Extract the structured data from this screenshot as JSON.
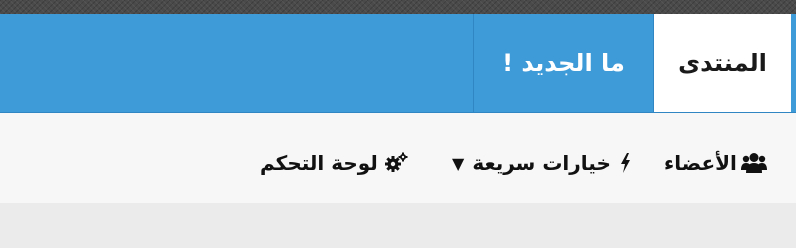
{
  "nav": {
    "tabs": [
      {
        "label": "المنتدى",
        "active": true
      },
      {
        "label": "ما الجديد !",
        "active": false
      }
    ],
    "accent_color": "#3f9ad8"
  },
  "subnav": {
    "members_label": "الأعضاء",
    "members_icon": "users-icon",
    "quick_label": "خيارات سريعة",
    "quick_icon": "bolt-icon",
    "quick_caret": "▼",
    "panel_label": "لوحة التحكم",
    "panel_icon": "cogs-icon"
  }
}
